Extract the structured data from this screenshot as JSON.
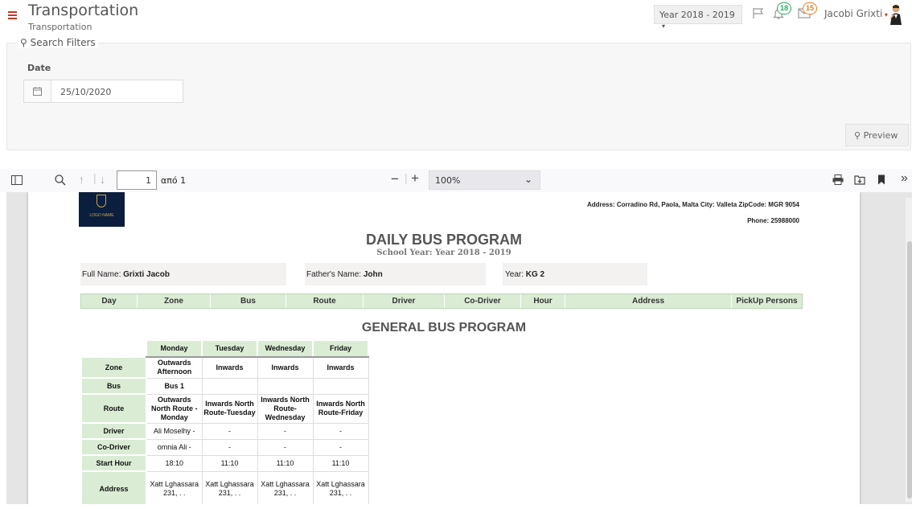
{
  "header": {
    "title": "Transportation",
    "subtitle": "Transportation",
    "year_select": "Year 2018 - 2019",
    "notifications_count": "18",
    "messages_count": "15",
    "user_name": "Jacobi Grixti"
  },
  "filters": {
    "legend": "Search Filters",
    "date_label": "Date",
    "date_value": "25/10/2020",
    "preview_label": "Preview"
  },
  "pdf_toolbar": {
    "page_number": "1",
    "page_of": "από 1",
    "zoom": "100%"
  },
  "report": {
    "logo_text": "LOGO NAME",
    "address": "Address: Corradino Rd, Paola, Malta  City: Valleta ZipCode: MGR 9054",
    "phone": "Phone: 25988000",
    "title": "DAILY BUS PROGRAM",
    "school_year_label": "School Year:",
    "school_year_value": "Year 2018 - 2019",
    "full_name_label": "Full Name:",
    "full_name_value": "Grixti Jacob",
    "father_label": "Father's Name:",
    "father_value": "John",
    "year_label": "Year:",
    "year_value": "KG 2",
    "columns": [
      "Day",
      "Zone",
      "Bus",
      "Route",
      "Driver",
      "Co-Driver",
      "Hour",
      "Address",
      "PickUp Persons"
    ],
    "general_title": "GENERAL BUS PROGRAM",
    "general_days": [
      "Monday",
      "Tuesday",
      "Wednesday",
      "Friday"
    ],
    "general_rows": [
      {
        "label": "Zone",
        "cells": [
          "Outwards Afternoon",
          "Inwards",
          "Inwards",
          "Inwards"
        ]
      },
      {
        "label": "Bus",
        "cells": [
          "Bus 1",
          "",
          "",
          ""
        ]
      },
      {
        "label": "Route",
        "cells": [
          "Outwards North Route - Monday",
          "Inwards North Route-Tuesday",
          "Inwards North Route-Wednesday",
          "Inwards North Route-Friday"
        ]
      },
      {
        "label": "Driver",
        "cells": [
          "Ali Moselhy -",
          "-",
          "-",
          "-"
        ]
      },
      {
        "label": "Co-Driver",
        "cells": [
          "omnia Ali -",
          "-",
          "-",
          "-"
        ]
      },
      {
        "label": "Start Hour",
        "cells": [
          "18:10",
          "11:10",
          "11:10",
          "11:10"
        ]
      },
      {
        "label": "Address",
        "cells": [
          "Xatt Lghassara 231, . .",
          "Xatt Lghassara 231, . .",
          "Xatt Lghassara 231, . .",
          "Xatt Lghassara 231, . ."
        ]
      }
    ]
  },
  "colors": {
    "accent_red": "#c0392b",
    "header_green": "#dbecd5",
    "badge_green": "#27ae60",
    "badge_orange": "#e67e22"
  }
}
